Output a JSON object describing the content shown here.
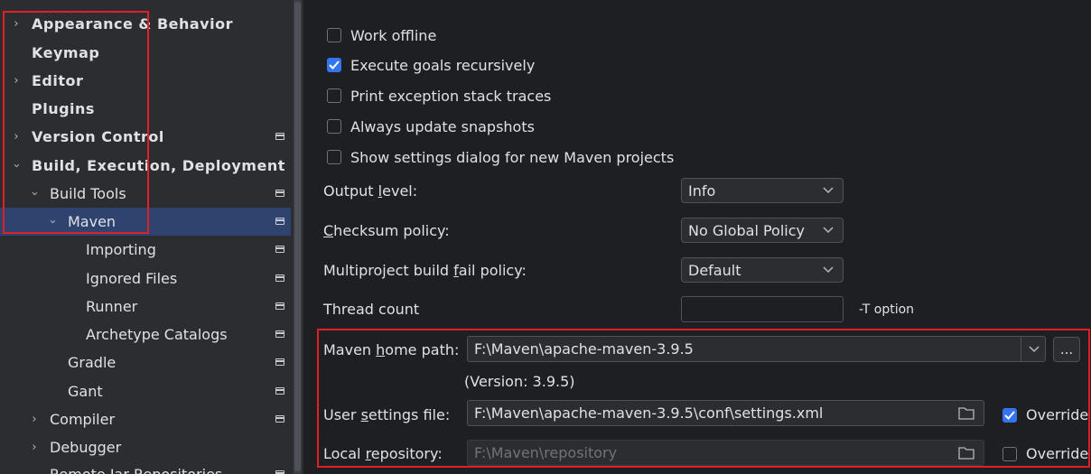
{
  "sidebar": {
    "items": [
      {
        "label": "Appearance & Behavior",
        "expandable": true
      },
      {
        "label": "Keymap",
        "expandable": false
      },
      {
        "label": "Editor",
        "expandable": true
      },
      {
        "label": "Plugins",
        "expandable": false
      },
      {
        "label": "Version Control",
        "expandable": true
      },
      {
        "label": "Build, Execution, Deployment",
        "expandable": true
      },
      {
        "label": "Build Tools",
        "expandable": true
      },
      {
        "label": "Maven",
        "expandable": true
      },
      {
        "label": "Importing"
      },
      {
        "label": "Ignored Files"
      },
      {
        "label": "Runner"
      },
      {
        "label": "Archetype Catalogs"
      },
      {
        "label": "Gradle"
      },
      {
        "label": "Gant"
      },
      {
        "label": "Compiler",
        "expandable": true
      },
      {
        "label": "Debugger",
        "expandable": true
      },
      {
        "label": "Remote Jar Repositories"
      }
    ]
  },
  "checkboxes": [
    {
      "label": "Work offline",
      "checked": false
    },
    {
      "label": "Execute goals recursively",
      "checked": true
    },
    {
      "label": "Print exception stack traces",
      "checked": false
    },
    {
      "label": "Always update snapshots",
      "checked": false
    },
    {
      "label": "Show settings dialog for new Maven projects",
      "checked": false
    }
  ],
  "form": {
    "output_level": {
      "pre": "Output ",
      "mn": "l",
      "post": "evel:",
      "value": "Info"
    },
    "checksum_policy": {
      "pre": "",
      "mn": "C",
      "post": "hecksum policy:",
      "value": "No Global Policy"
    },
    "multiproject": {
      "pre": "Multiproject build ",
      "mn": "f",
      "post": "ail policy:",
      "value": "Default"
    },
    "thread_count": {
      "label": "Thread count",
      "value": "",
      "hint": "-T option"
    }
  },
  "maven": {
    "home_label": {
      "pre": "Maven ",
      "mn": "h",
      "post": "ome path:"
    },
    "home_value": "F:\\Maven\\apache-maven-3.9.5",
    "version": "(Version: 3.9.5)",
    "browse_label": "...",
    "settings_label": {
      "pre": "User ",
      "mn": "s",
      "post": "ettings file:"
    },
    "settings_value": "F:\\Maven\\apache-maven-3.9.5\\conf\\settings.xml",
    "settings_override": {
      "label": "Override",
      "checked": true
    },
    "repo_label": {
      "pre": "Local ",
      "mn": "r",
      "post": "epository:"
    },
    "repo_value": "F:\\Maven\\repository",
    "repo_override": {
      "label": "Override",
      "checked": false
    }
  },
  "colors": {
    "accent": "#3574f0",
    "selection": "#2e436e",
    "highlight_box": "#e01f26"
  }
}
